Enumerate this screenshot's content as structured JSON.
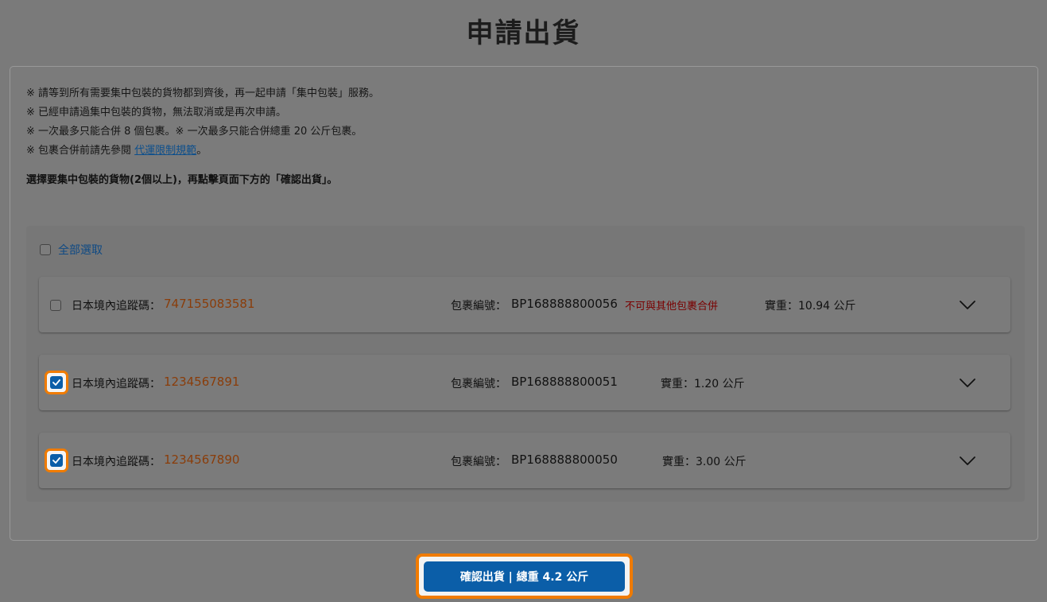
{
  "page": {
    "title": "申請出貨"
  },
  "notes": [
    "※ 請等到所有需要集中包裝的貨物都到齊後，再一起申請「集中包裝」服務。",
    "※ 已經申請過集中包裝的貨物，無法取消或是再次申請。",
    "※ 一次最多只能合併 8 個包裹。※ 一次最多只能合併總重 20 公斤包裹。"
  ],
  "note_link": {
    "prefix": "※ 包裹合併前請先參閱 ",
    "link_text": "代運限制規範",
    "suffix": "。"
  },
  "instruction": "選擇要集中包裝的貨物(2個以上)，再點擊頁面下方的「確認出貨」。",
  "select_all": {
    "label": "全部選取",
    "checked": false
  },
  "packages": [
    {
      "checked": false,
      "tracking_label": "日本境內追蹤碼：",
      "tracking_no": "747155083581",
      "package_label": "包裹編號：",
      "package_no": "BP168888800056",
      "warning": "不可與其他包裹合併",
      "weight": "實重：10.94 公斤"
    },
    {
      "checked": true,
      "tracking_label": "日本境內追蹤碼：",
      "tracking_no": "1234567891",
      "package_label": "包裹編號：",
      "package_no": "BP168888800051",
      "warning": "",
      "weight": "實重：1.20 公斤"
    },
    {
      "checked": true,
      "tracking_label": "日本境內追蹤碼：",
      "tracking_no": "1234567890",
      "package_label": "包裹編號：",
      "package_no": "BP168888800050",
      "warning": "",
      "weight": "實重：3.00 公斤"
    }
  ],
  "confirm": {
    "label": "確認出貨 | 總重 4.2 公斤"
  },
  "colors": {
    "accent": "#0b5ea8",
    "highlight": "#f07b00",
    "tracking": "#8a3d0a",
    "warning": "#7a0000",
    "link": "#0d4f8c"
  }
}
